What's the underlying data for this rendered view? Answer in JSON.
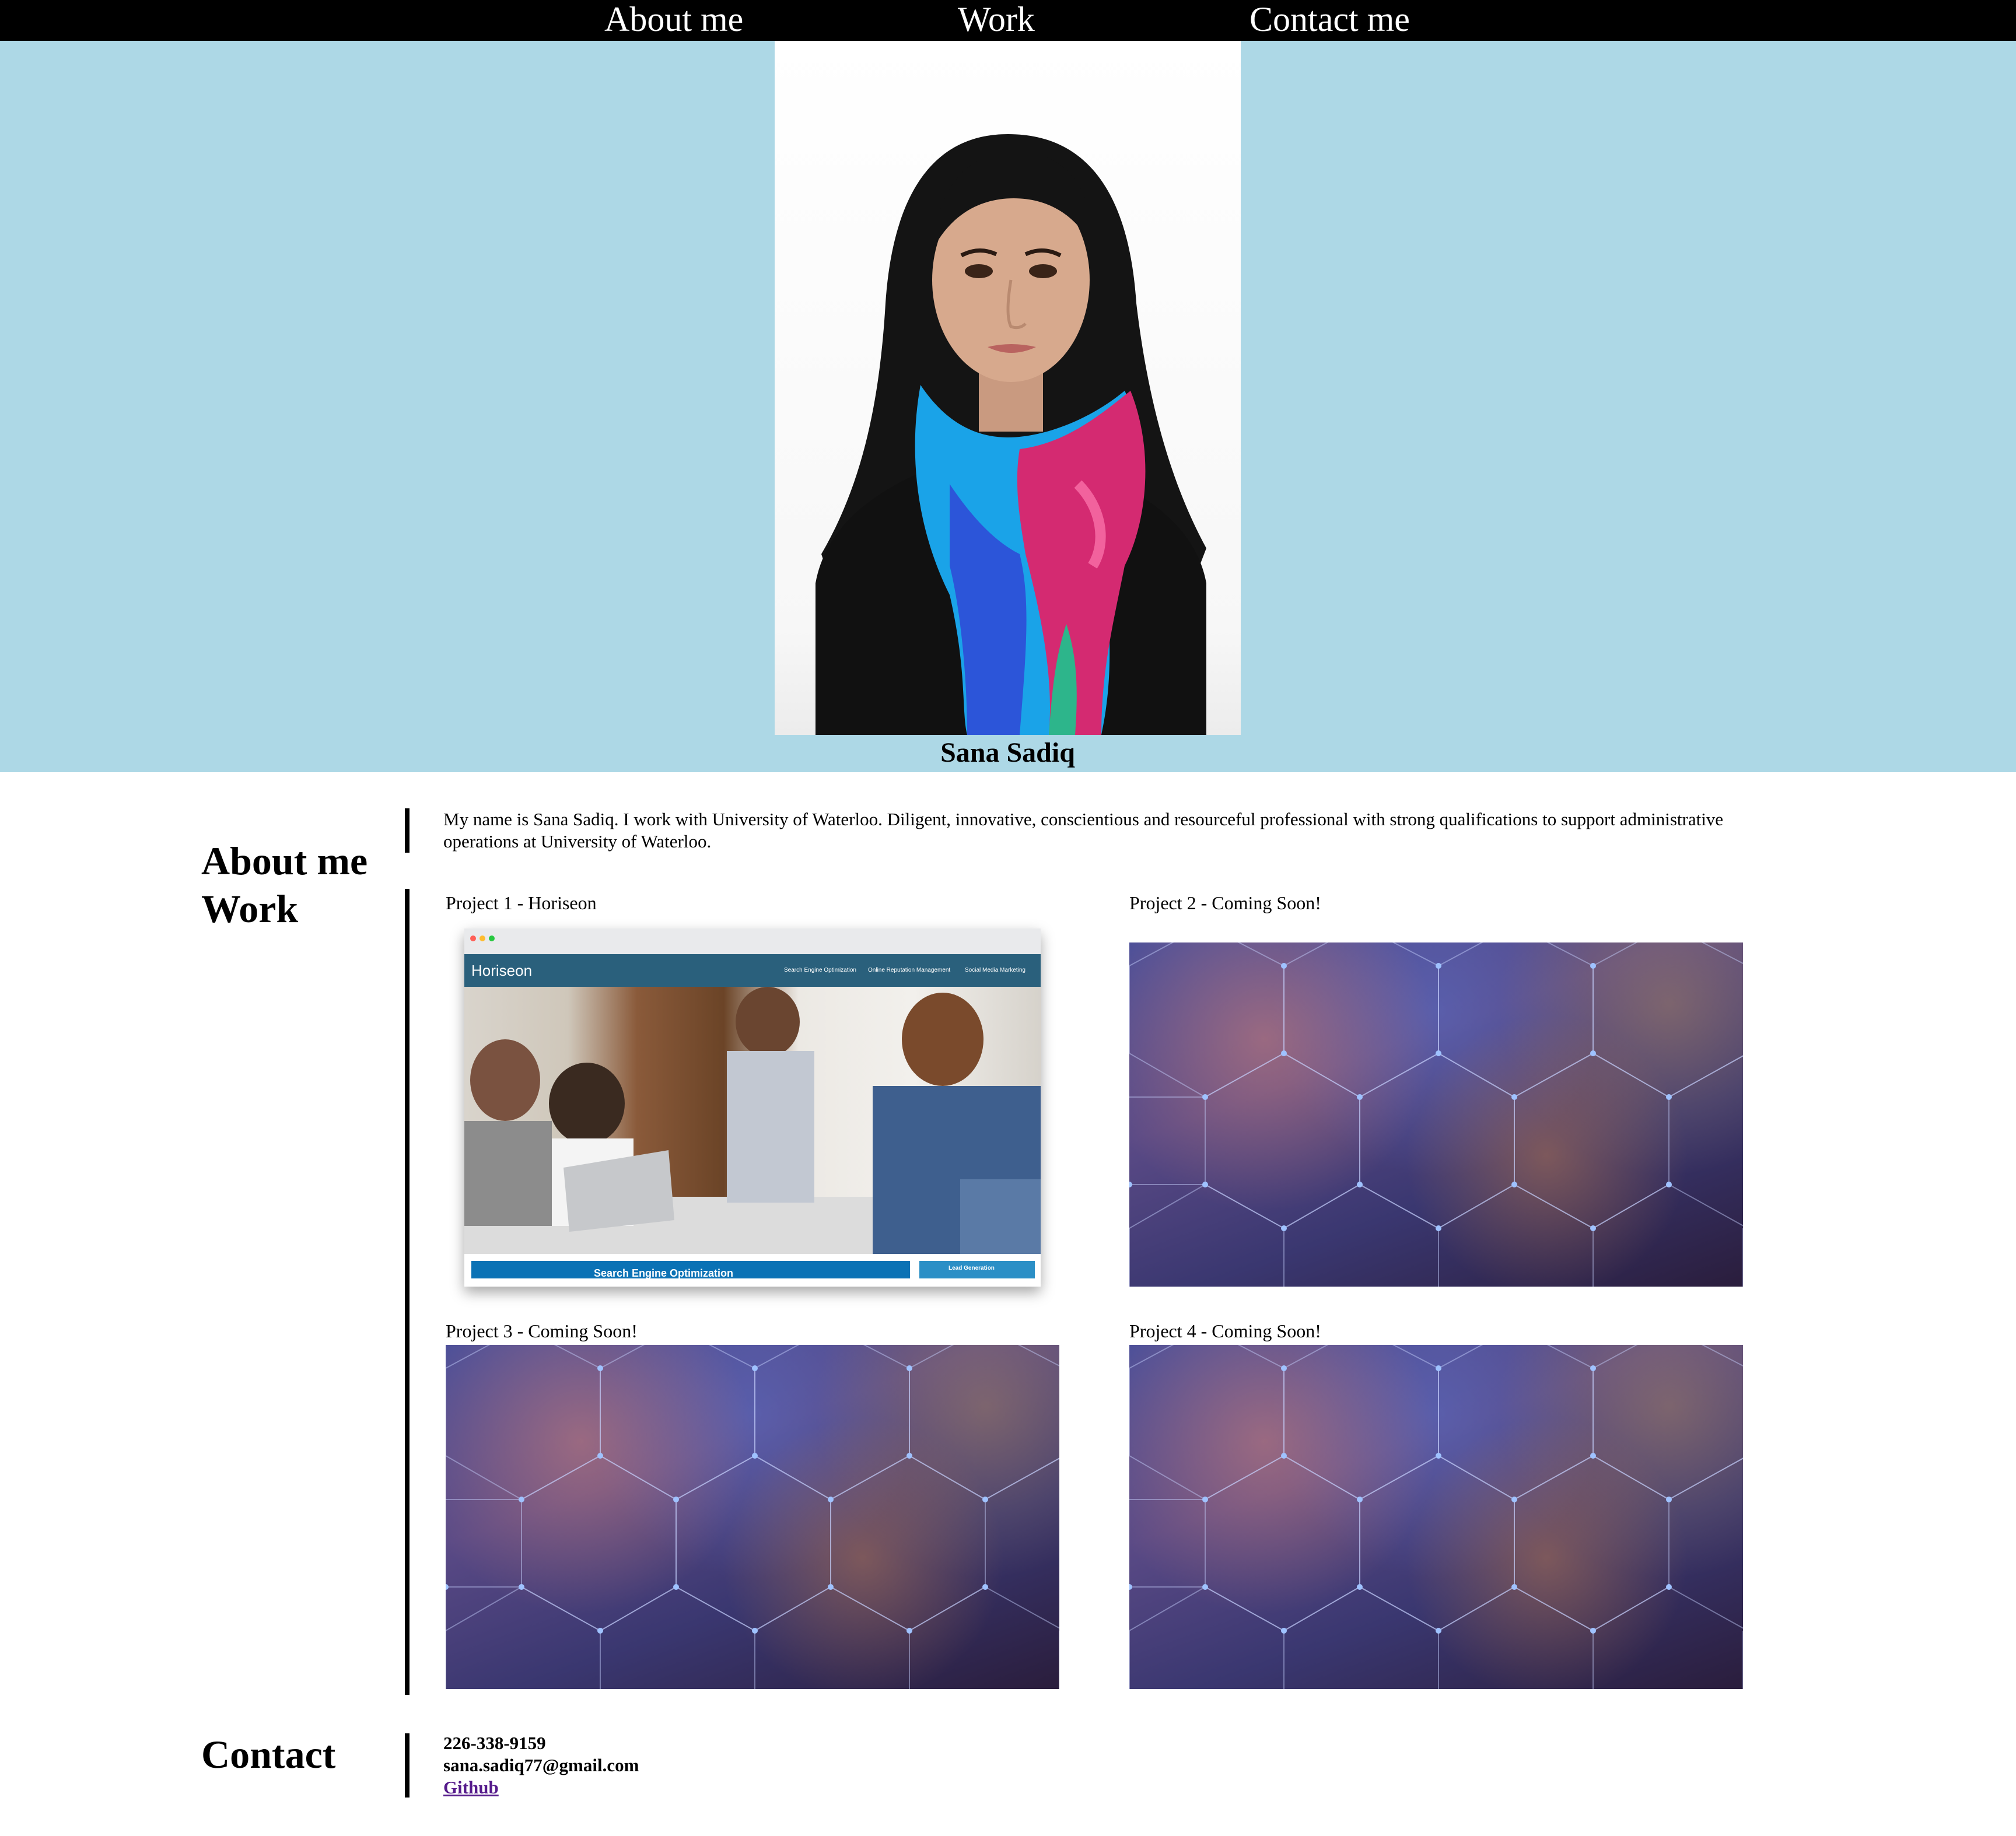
{
  "nav": {
    "items": [
      {
        "label": "About me"
      },
      {
        "label": "Work"
      },
      {
        "label": "Contact me"
      }
    ]
  },
  "hero": {
    "name": "Sana Sadiq",
    "background_color": "#add8e6"
  },
  "about": {
    "heading": "About me",
    "text": "My name is Sana Sadiq. I work with University of Waterloo. Diligent, innovative, conscientious and resourceful professional with strong qualifications to support administrative operations at University of Waterloo."
  },
  "work": {
    "heading": "Work",
    "projects": [
      {
        "label": "Project 1 - Horiseon",
        "screenshot": {
          "brand": "Horiseon",
          "menu": [
            "Search Engine Optimization",
            "Online Reputation Management",
            "Social Media Marketing"
          ],
          "banner": "Search Engine Optimization",
          "side_banner": "Lead Generation"
        }
      },
      {
        "label": "Project 2 - Coming Soon!"
      },
      {
        "label": "Project 3 - Coming Soon!"
      },
      {
        "label": "Project 4 - Coming Soon!"
      }
    ]
  },
  "contact": {
    "heading": "Contact",
    "phone": "226-338-9159",
    "email": "sana.sadiq77@gmail.com",
    "github_label": "Github"
  }
}
